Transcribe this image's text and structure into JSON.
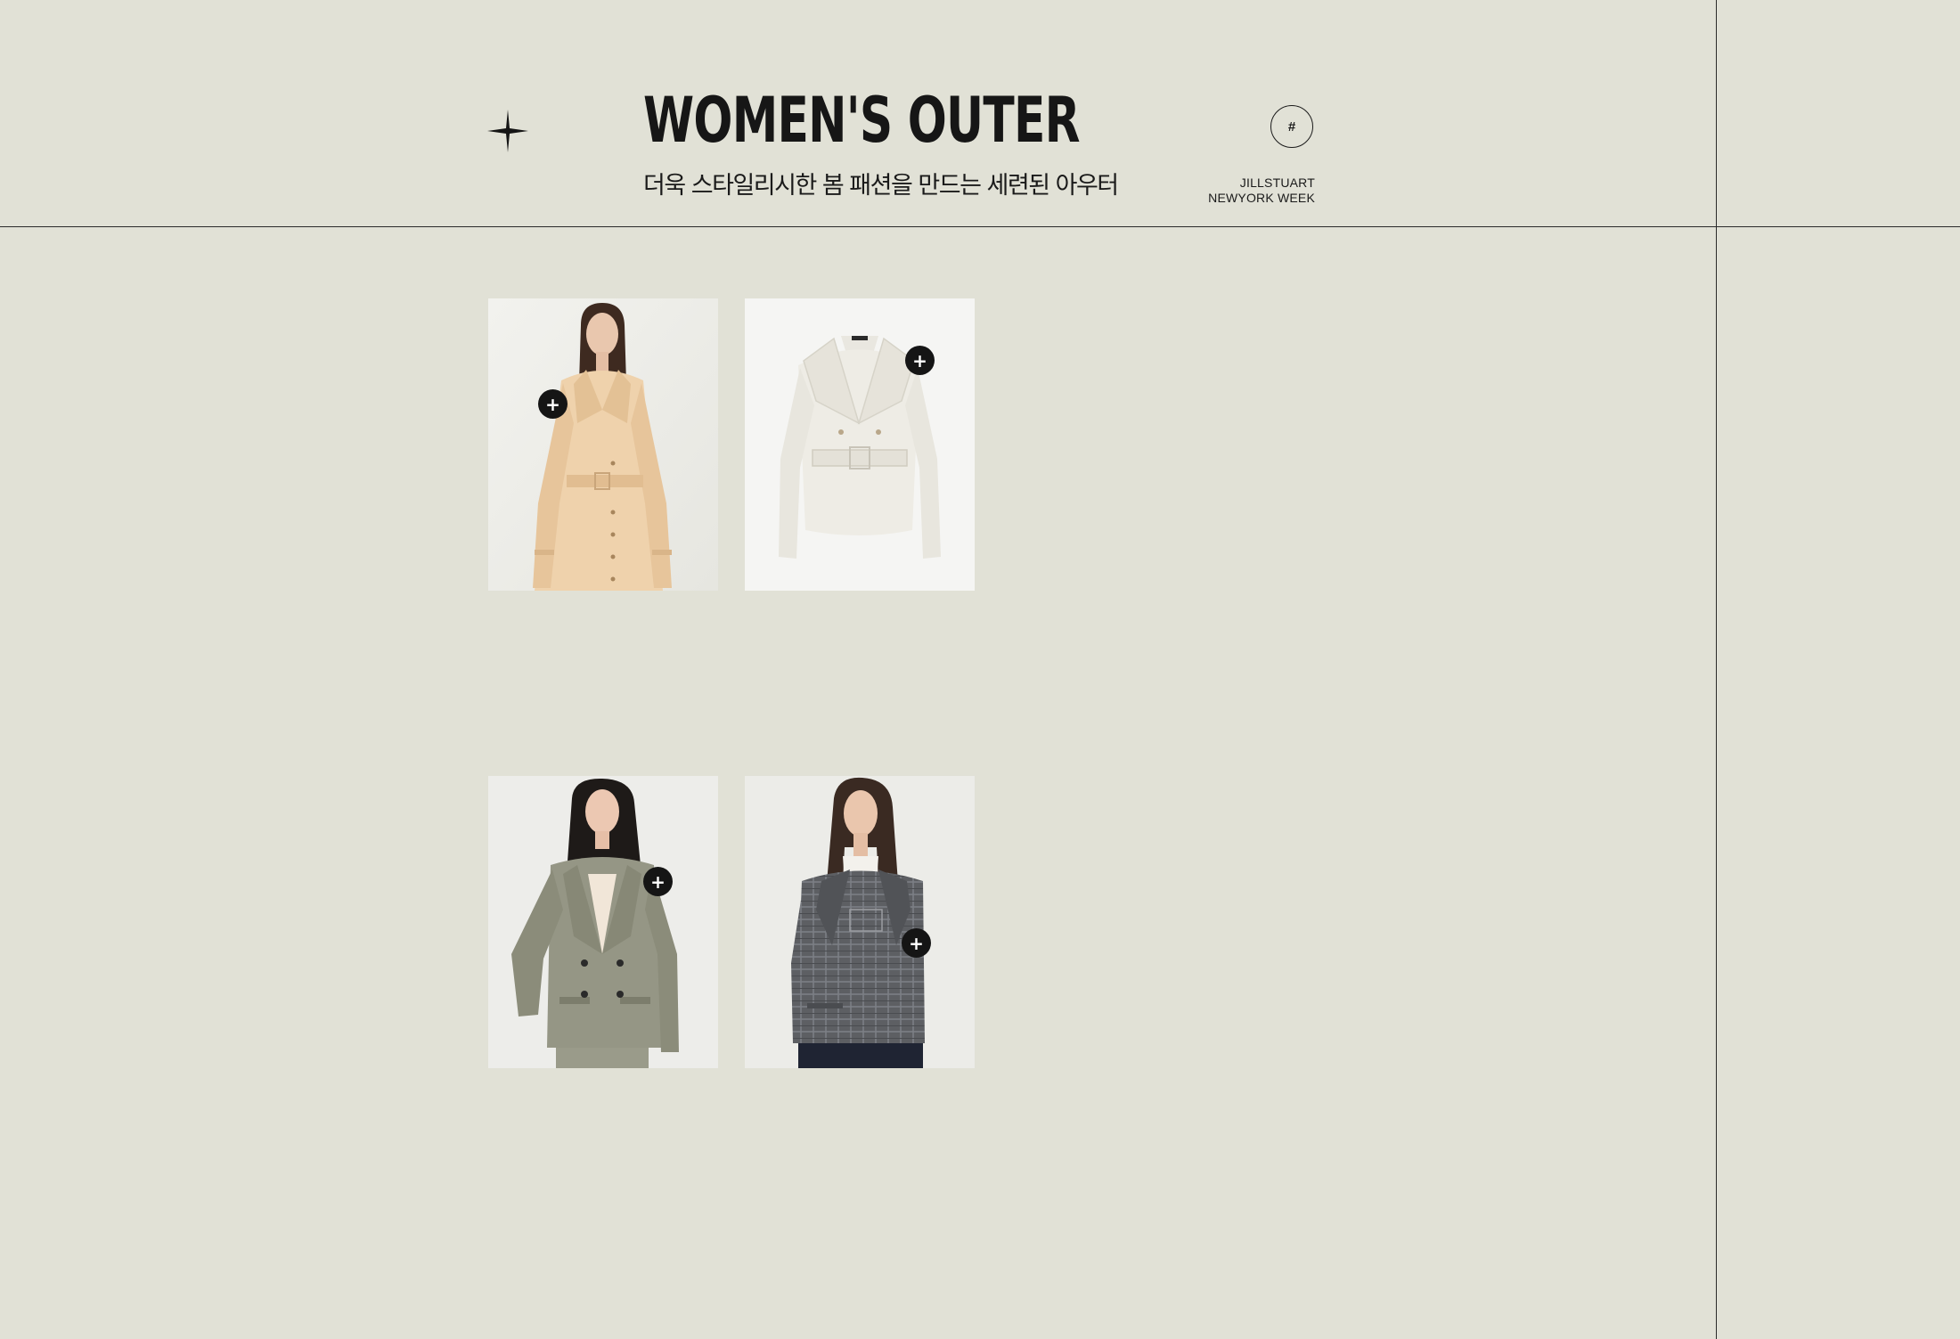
{
  "header": {
    "title": "WOMEN'S OUTER",
    "subtitle": "더욱 스타일리시한 봄 패션을 만드는 세련된 아우터",
    "hash_label": "#",
    "brand_line1": "JILLSTUART",
    "brand_line2": "NEWYORK WEEK"
  },
  "products": [
    {
      "name": "beige belted trench coat",
      "hotspot_label": "+"
    },
    {
      "name": "ivory belted short jacket",
      "hotspot_label": "+"
    },
    {
      "name": "khaki double-breasted blazer",
      "hotspot_label": "+"
    },
    {
      "name": "grey check cropped jacket",
      "hotspot_label": "+"
    }
  ],
  "colors": {
    "background": "#e1e1d6",
    "line": "#2a2a2a",
    "hotspot": "#151515"
  }
}
